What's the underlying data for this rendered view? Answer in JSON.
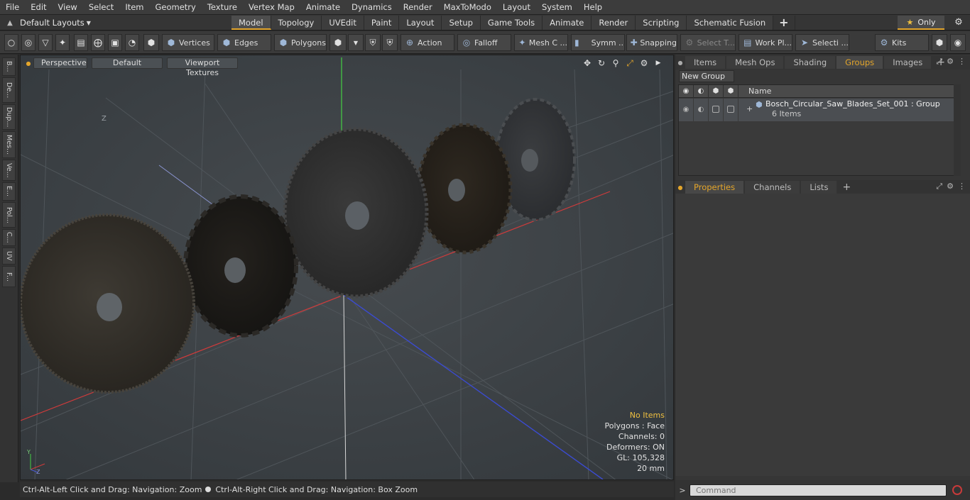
{
  "menu": [
    "File",
    "Edit",
    "View",
    "Select",
    "Item",
    "Geometry",
    "Texture",
    "Vertex Map",
    "Animate",
    "Dynamics",
    "Render",
    "MaxToModo",
    "Layout",
    "System",
    "Help"
  ],
  "layout": {
    "label": "Default Layouts",
    "home_icon": "home-icon"
  },
  "mode_tabs": [
    "Model",
    "Topology",
    "UVEdit",
    "Paint",
    "Layout",
    "Setup",
    "Game Tools",
    "Animate",
    "Render",
    "Scripting",
    "Schematic Fusion"
  ],
  "mode_tab_plus": "+",
  "only_label": "Only",
  "toolbar": {
    "vertices": "Vertices",
    "edges": "Edges",
    "polygons": "Polygons",
    "action": "Action",
    "falloff": "Falloff",
    "mesh_c": "Mesh C ...",
    "symm": "Symm ...",
    "snapping": "Snapping",
    "select_t": "Select T...",
    "work_pl": "Work Pl...",
    "selecti": "Selecti ...",
    "kits": "Kits"
  },
  "left_tabs": [
    "B...",
    "De...",
    "Dup...",
    "Mes...",
    "Ve...",
    "E...",
    "Pol...",
    "C...",
    "UV",
    "F..."
  ],
  "viewport": {
    "perspective": "Perspective",
    "default": "Default",
    "textures": "Viewport Textures",
    "axis_label": "Z"
  },
  "info": {
    "items": "No Items",
    "polygons": "Polygons : Face",
    "channels": "Channels: 0",
    "deformers": "Deformers: ON",
    "gl": "GL: 105,328",
    "scale": "20 mm"
  },
  "status": {
    "left": "Ctrl-Alt-Left Click and Drag: Navigation: Zoom",
    "right": "Ctrl-Alt-Right Click and Drag: Navigation: Box Zoom"
  },
  "panel_tabs_top": [
    "Items",
    "Mesh Ops",
    "Shading",
    "Groups",
    "Images"
  ],
  "panel_tabs_top_active": "Groups",
  "new_group": "New Group",
  "list_header_name": "Name",
  "group": {
    "name": "Bosch_Circular_Saw_Blades_Set_001 : Group",
    "count": "6 Items"
  },
  "panel_tabs_bottom": [
    "Properties",
    "Channels",
    "Lists"
  ],
  "command_placeholder": "Command",
  "colors": {
    "accent": "#e3a52b",
    "x_axis": "#d03b3b",
    "y_axis": "#3bd03b",
    "z_axis": "#3b4bd0"
  }
}
